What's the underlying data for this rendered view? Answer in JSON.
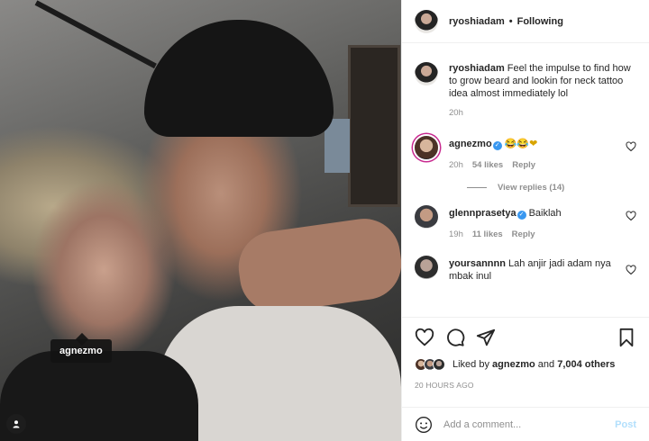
{
  "photo": {
    "tag_label": "agnezmo"
  },
  "header": {
    "username": "ryoshiadam",
    "separator": "•",
    "follow_status": "Following"
  },
  "caption": {
    "username": "ryoshiadam",
    "text": "Feel the impulse to find how to grow beard and lookin for neck tattoo idea almost immediately lol",
    "time": "20h"
  },
  "comments": [
    {
      "username": "agnezmo",
      "verified": true,
      "text": "😂😂❤",
      "time": "20h",
      "likes": "54 likes",
      "reply": "Reply",
      "view_replies": "View replies (14)"
    },
    {
      "username": "glennprasetya",
      "verified": true,
      "text": "Baiklah",
      "time": "19h",
      "likes": "11 likes",
      "reply": "Reply"
    },
    {
      "username": "yoursannnn",
      "verified": false,
      "text": "Lah anjir jadi adam nya mbak inul"
    }
  ],
  "likes": {
    "prefix": "Liked by",
    "user": "agnezmo",
    "and": "and",
    "count": "7,004 others"
  },
  "timestamp": "20 HOURS AGO",
  "add_comment": {
    "placeholder": "Add a comment...",
    "post_label": "Post"
  },
  "colors": {
    "verified": "#3897f0",
    "post_disabled": "#b2dffc",
    "heart": "#ed4956",
    "meta_text": "#8e8e8e"
  },
  "icons": [
    "heart-icon",
    "comment-icon",
    "share-icon",
    "bookmark-icon",
    "emoji-icon",
    "user-tag-icon",
    "verified-icon"
  ]
}
